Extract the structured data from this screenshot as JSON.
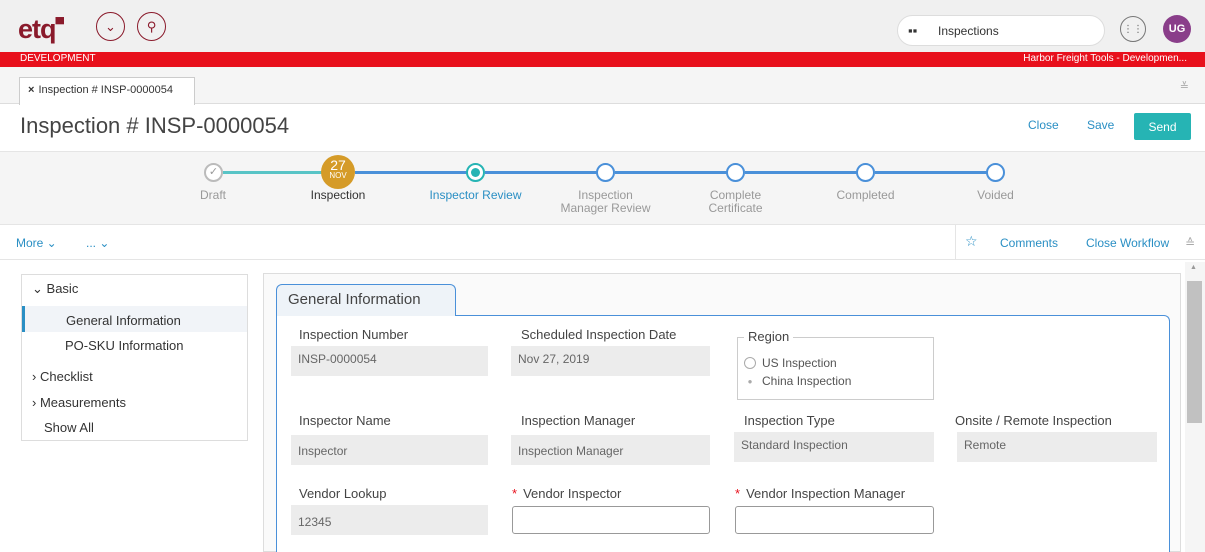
{
  "header": {
    "logo": "etq",
    "search_value": "Inspections",
    "avatar_initials": "UG"
  },
  "env_bar": {
    "left": "DEVELOPMENT",
    "right": "Harbor Freight Tools - Developmen..."
  },
  "tabs": [
    {
      "close": "×",
      "label": "Inspection # INSP-0000054"
    }
  ],
  "document": {
    "title": "Inspection # INSP-0000054",
    "close": "Close",
    "save": "Save",
    "send": "Send"
  },
  "workflow": {
    "date_day": "27",
    "date_month": "NOV",
    "steps": [
      {
        "label": "Draft"
      },
      {
        "label": "Inspection"
      },
      {
        "label": "Inspector Review"
      },
      {
        "label": "Inspection\nManager Review"
      },
      {
        "label": "Complete\nCertificate"
      },
      {
        "label": "Completed"
      },
      {
        "label": "Voided"
      }
    ]
  },
  "action_bar": {
    "more": "More ⌄",
    "ellipsis": "... ⌄",
    "comments": "Comments",
    "close_workflow": "Close Workflow"
  },
  "left_nav": {
    "basic": "Basic",
    "general_info": "General Information",
    "po_sku": "PO-SKU Information",
    "checklist": "Checklist",
    "measurements": "Measurements",
    "show_all": "Show All"
  },
  "form": {
    "section_title": "General Information",
    "inspection_number": {
      "label": "Inspection Number",
      "value": "INSP-0000054"
    },
    "scheduled_date": {
      "label": "Scheduled Inspection Date",
      "value": "Nov 27, 2019"
    },
    "region": {
      "label": "Region",
      "options": [
        "US Inspection",
        "China Inspection"
      ]
    },
    "inspector_name": {
      "label": "Inspector Name",
      "value": "Inspector"
    },
    "inspection_manager": {
      "label": "Inspection Manager",
      "value": "Inspection Manager"
    },
    "inspection_type": {
      "label": "Inspection Type",
      "value": "Standard Inspection"
    },
    "onsite_remote": {
      "label": "Onsite / Remote Inspection",
      "value": "Remote"
    },
    "vendor_lookup": {
      "label": "Vendor Lookup",
      "value": "12345"
    },
    "vendor_inspector": {
      "label": "Vendor Inspector",
      "value": ""
    },
    "vendor_inspection_manager": {
      "label": "Vendor Inspection Manager",
      "value": ""
    },
    "required_mark": "*"
  },
  "colors": {
    "brand": "#8a1a2b",
    "env_bar": "#e8101c",
    "accent": "#26b4b4",
    "link": "#2a8fc4"
  }
}
